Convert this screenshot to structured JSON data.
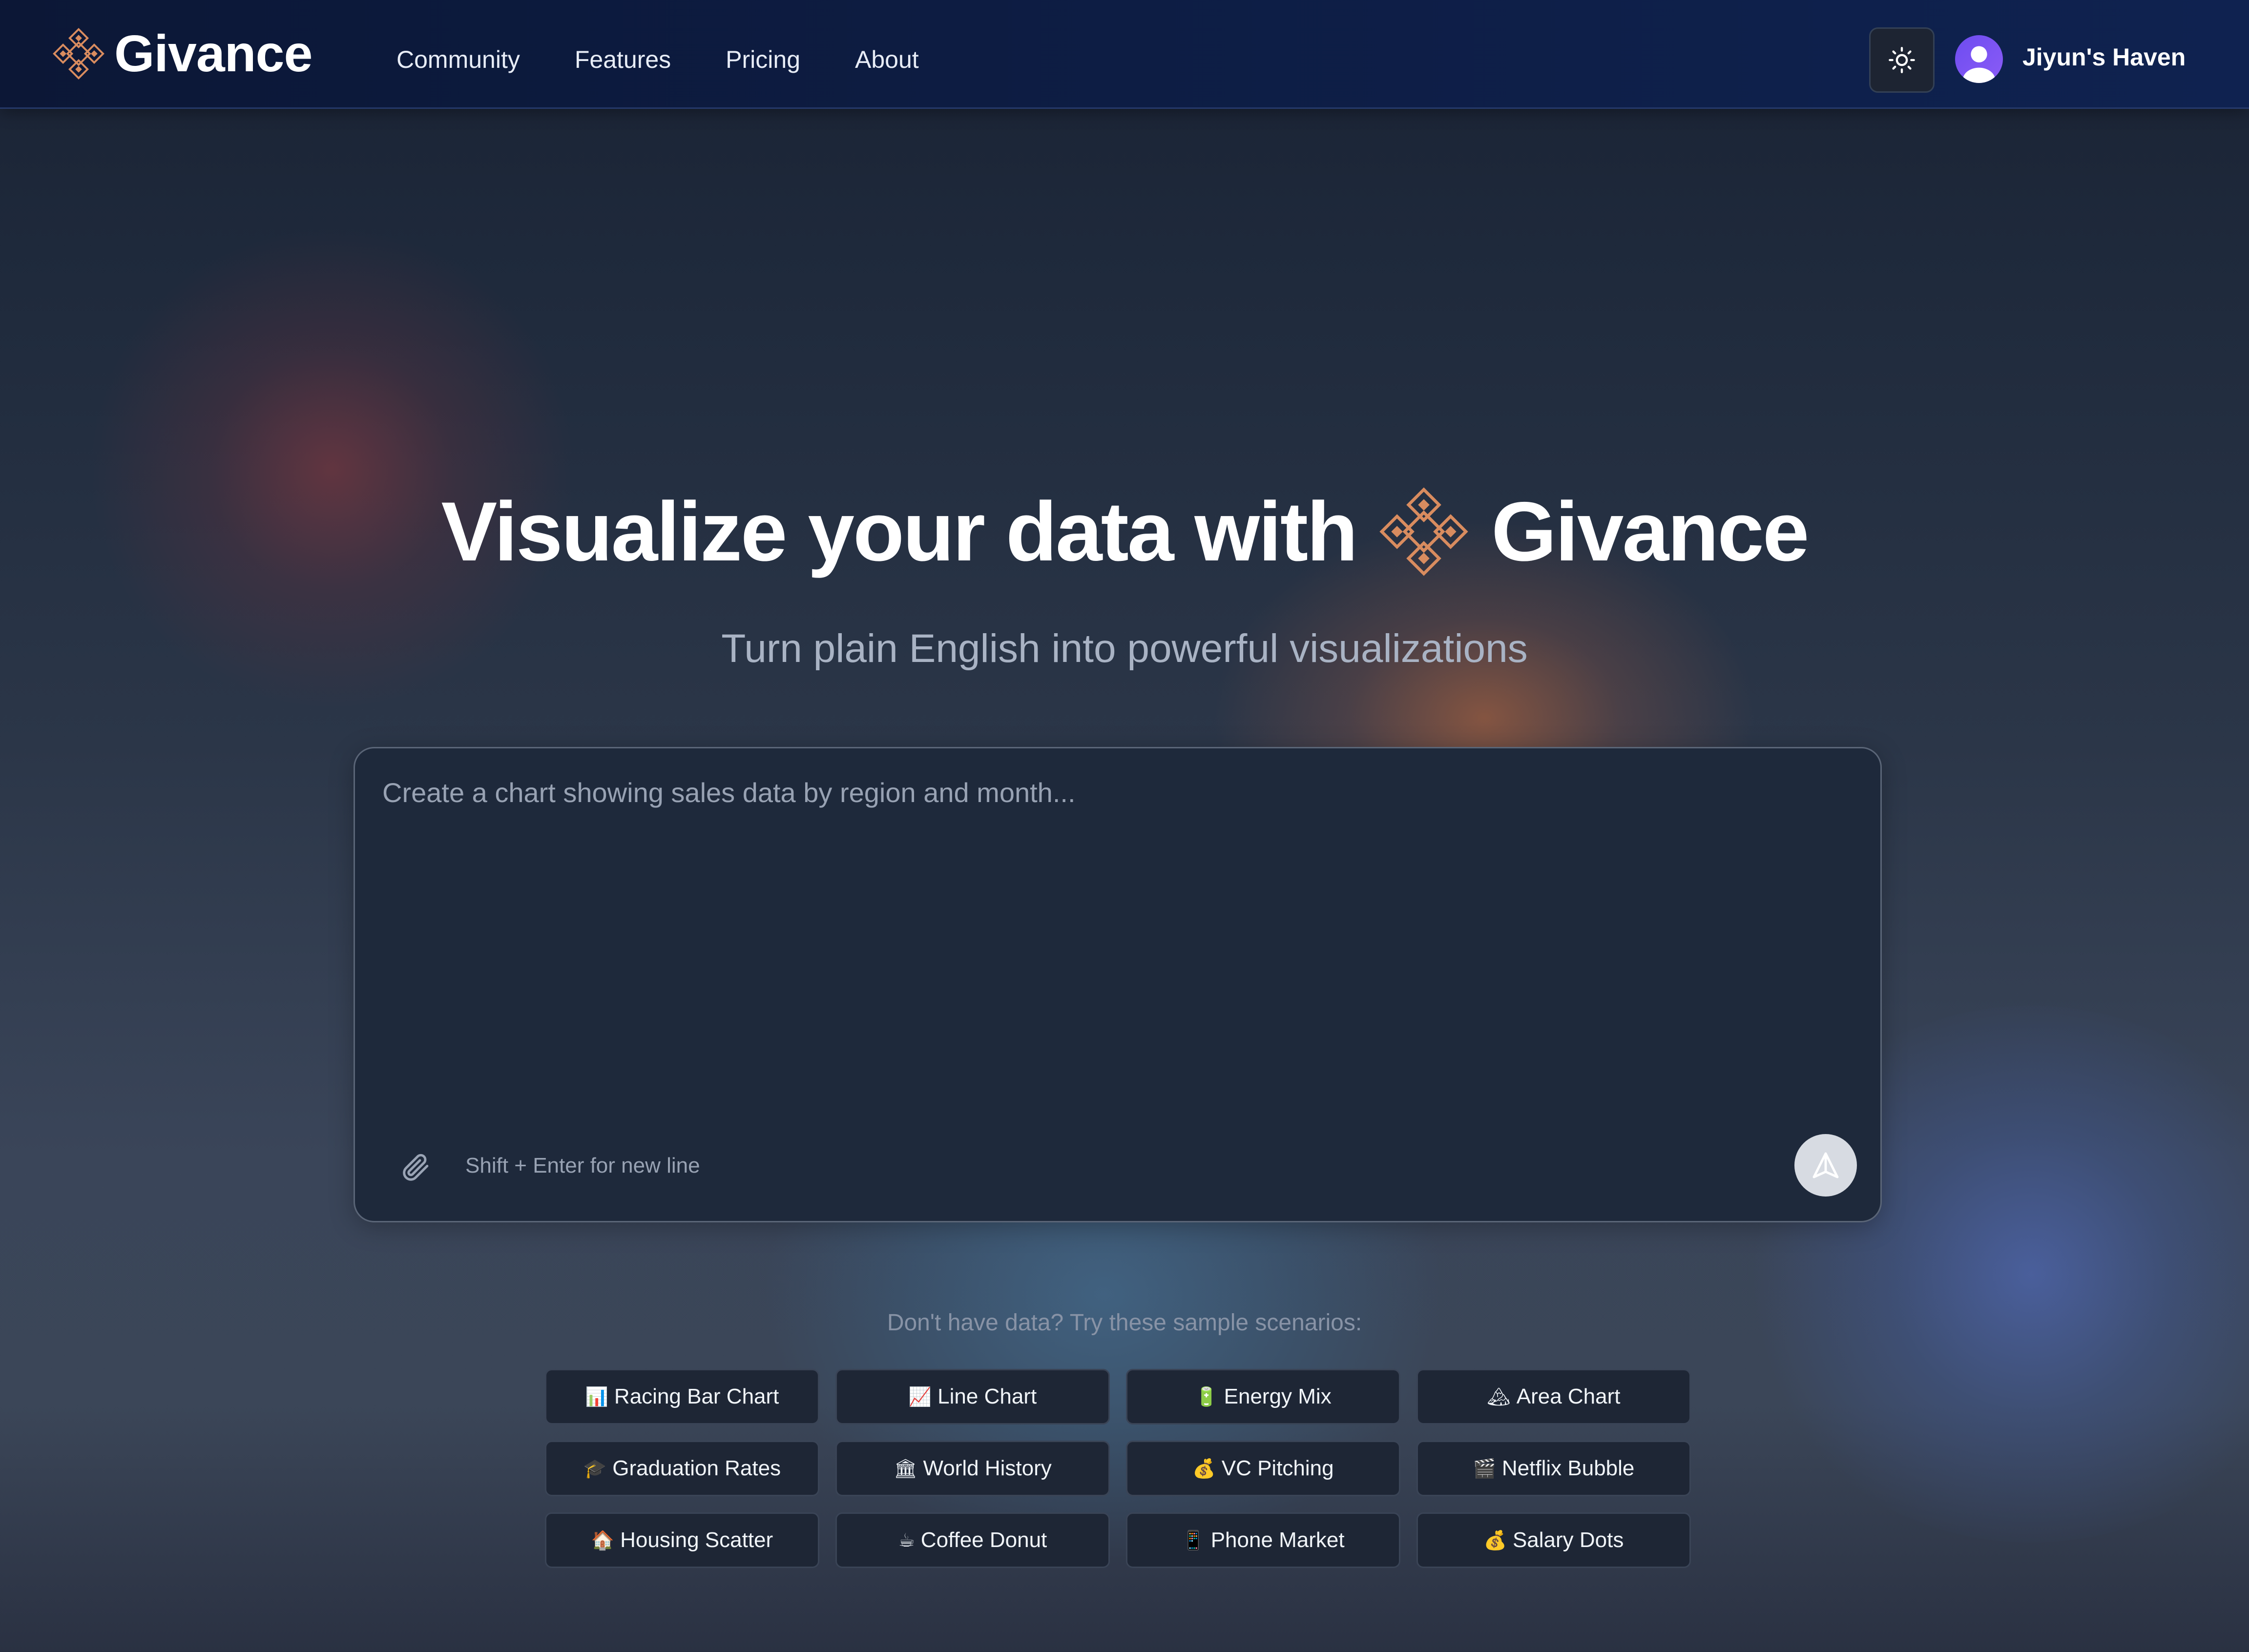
{
  "app": {
    "name": "Givance"
  },
  "nav": {
    "links": [
      {
        "label": "Community"
      },
      {
        "label": "Features"
      },
      {
        "label": "Pricing"
      },
      {
        "label": "About"
      }
    ],
    "theme_toggle_icon": "sun-icon",
    "user": {
      "name": "Jiyun's Haven",
      "avatar_color": "#7c4dff"
    }
  },
  "hero": {
    "title_prefix": "Visualize your data with",
    "title_brand": "Givance",
    "subtitle": "Turn plain English into powerful visualizations"
  },
  "prompt": {
    "placeholder": "Create a chart showing sales data by region and month...",
    "value": "",
    "hint": "Shift + Enter for new line",
    "attach_icon": "paperclip-icon",
    "send_icon": "send-icon"
  },
  "samples": {
    "label": "Don't have data? Try these sample scenarios:",
    "items": [
      {
        "emoji": "📊",
        "label": "Racing Bar Chart"
      },
      {
        "emoji": "📈",
        "label": "Line Chart"
      },
      {
        "emoji": "🔋",
        "label": "Energy Mix"
      },
      {
        "emoji": "🏔",
        "label": "Area Chart"
      },
      {
        "emoji": "🎓",
        "label": "Graduation Rates"
      },
      {
        "emoji": "🏛",
        "label": "World History"
      },
      {
        "emoji": "💰",
        "label": "VC Pitching"
      },
      {
        "emoji": "🎬",
        "label": "Netflix Bubble"
      },
      {
        "emoji": "🏠",
        "label": "Housing Scatter"
      },
      {
        "emoji": "☕",
        "label": "Coffee Donut"
      },
      {
        "emoji": "📱",
        "label": "Phone Market"
      },
      {
        "emoji": "💰",
        "label": "Salary Dots"
      }
    ]
  },
  "colors": {
    "brand_accent": "#d98c5f",
    "nav_bg": "#0d1d44",
    "prompt_bg": "#1e293b",
    "send_button_bg": "#d7dbe2"
  }
}
